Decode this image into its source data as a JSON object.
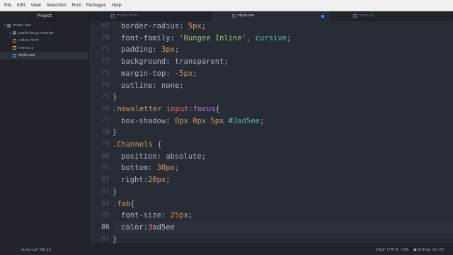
{
  "menu": [
    "File",
    "Edit",
    "View",
    "Selection",
    "Find",
    "Packages",
    "Help"
  ],
  "sidebar": {
    "title": "Project",
    "items": [
      {
        "label": "menu bar",
        "kind": "folder",
        "expanded": true
      },
      {
        "label": "particles.js-master",
        "kind": "folder",
        "expanded": false
      },
      {
        "label": "index.html",
        "kind": "file",
        "type": "html"
      },
      {
        "label": "menu.js",
        "kind": "file",
        "type": "js"
      },
      {
        "label": "style.css",
        "kind": "file",
        "type": "css",
        "selected": true
      }
    ]
  },
  "tabs": [
    {
      "label": "index.html",
      "active": false
    },
    {
      "label": "style.css",
      "active": true,
      "modified": true
    },
    {
      "label": "menu.js",
      "active": false
    }
  ],
  "editor": {
    "line_numbers": [
      "69",
      "70",
      "71",
      "72",
      "73",
      "74",
      "75",
      "76",
      "77",
      "78",
      "79",
      "80",
      "81",
      "82",
      "83",
      "84",
      "85",
      "86",
      "87"
    ],
    "current_line": "86",
    "lines": [
      {
        "ind": 1,
        "t": [
          [
            "p",
            "border-radius: "
          ],
          [
            "n",
            "5px"
          ],
          [
            "p",
            ";"
          ]
        ]
      },
      {
        "ind": 1,
        "t": [
          [
            "p",
            "font-family: "
          ],
          [
            "s",
            "'Bungee Inline'"
          ],
          [
            "p",
            ", "
          ],
          [
            "s2",
            "cursive"
          ],
          [
            "p",
            ";"
          ]
        ]
      },
      {
        "ind": 1,
        "t": [
          [
            "p",
            "padding: "
          ],
          [
            "n",
            "3px"
          ],
          [
            "p",
            ";"
          ]
        ]
      },
      {
        "ind": 1,
        "t": [
          [
            "p",
            "background: transparent;"
          ]
        ]
      },
      {
        "ind": 1,
        "t": [
          [
            "p",
            "margin-top: "
          ],
          [
            "n",
            "-5px"
          ],
          [
            "p",
            ";"
          ]
        ]
      },
      {
        "ind": 1,
        "t": [
          [
            "p",
            "outline: none;"
          ]
        ]
      },
      {
        "ind": 0,
        "t": [
          [
            "p",
            "}"
          ]
        ]
      },
      {
        "ind": 0,
        "t": [
          [
            "c",
            ".newsletter "
          ],
          [
            "g",
            "input"
          ],
          [
            "k",
            ":focus"
          ],
          [
            "p",
            "{"
          ]
        ]
      },
      {
        "ind": 1,
        "t": [
          [
            "p",
            "box-shadow: "
          ],
          [
            "n",
            "0px"
          ],
          [
            "p",
            " "
          ],
          [
            "n",
            "0px"
          ],
          [
            "p",
            " "
          ],
          [
            "n",
            "5px"
          ],
          [
            "p",
            " "
          ],
          [
            "h",
            "#3ad5ee"
          ],
          [
            "p",
            ";"
          ]
        ]
      },
      {
        "ind": 0,
        "t": [
          [
            "p",
            "}"
          ]
        ]
      },
      {
        "ind": 0,
        "t": [
          [
            "c",
            ".Channels "
          ],
          [
            "p",
            "{"
          ]
        ]
      },
      {
        "ind": 1,
        "t": [
          [
            "p",
            "position: absolute;"
          ]
        ]
      },
      {
        "ind": 1,
        "t": [
          [
            "p",
            "bottom: "
          ],
          [
            "n",
            "30px"
          ],
          [
            "p",
            ";"
          ]
        ]
      },
      {
        "ind": 1,
        "t": [
          [
            "p",
            "right:"
          ],
          [
            "n",
            "20px"
          ],
          [
            "p",
            ";"
          ]
        ]
      },
      {
        "ind": 0,
        "t": [
          [
            "p",
            "}"
          ]
        ]
      },
      {
        "ind": 0,
        "t": [
          [
            "c",
            ".fab"
          ],
          [
            "p",
            "{"
          ]
        ]
      },
      {
        "ind": 1,
        "t": [
          [
            "p",
            "font-size: "
          ],
          [
            "n",
            "25px"
          ],
          [
            "p",
            ";"
          ]
        ]
      },
      {
        "ind": 1,
        "t": [
          [
            "p",
            "color:"
          ],
          [
            "n",
            "3"
          ],
          [
            "p",
            "ad5ee"
          ]
        ]
      },
      {
        "ind": 0,
        "t": [
          [
            "p",
            "}"
          ]
        ]
      }
    ]
  },
  "status": {
    "file": "style.css*",
    "position": "86:13",
    "line_ending": "CRLF",
    "encoding": "UTF-8",
    "grammar": "CSS",
    "github": "GitHub",
    "git": "Git (0)"
  },
  "colors": {
    "background": "#282c34",
    "sidebar": "#21252b",
    "selector": "#d19a66",
    "string": "#98c379",
    "keyword": "#c678dd",
    "tag": "#e06c75",
    "hash": "#56b6c2",
    "accent": "#528bff"
  }
}
